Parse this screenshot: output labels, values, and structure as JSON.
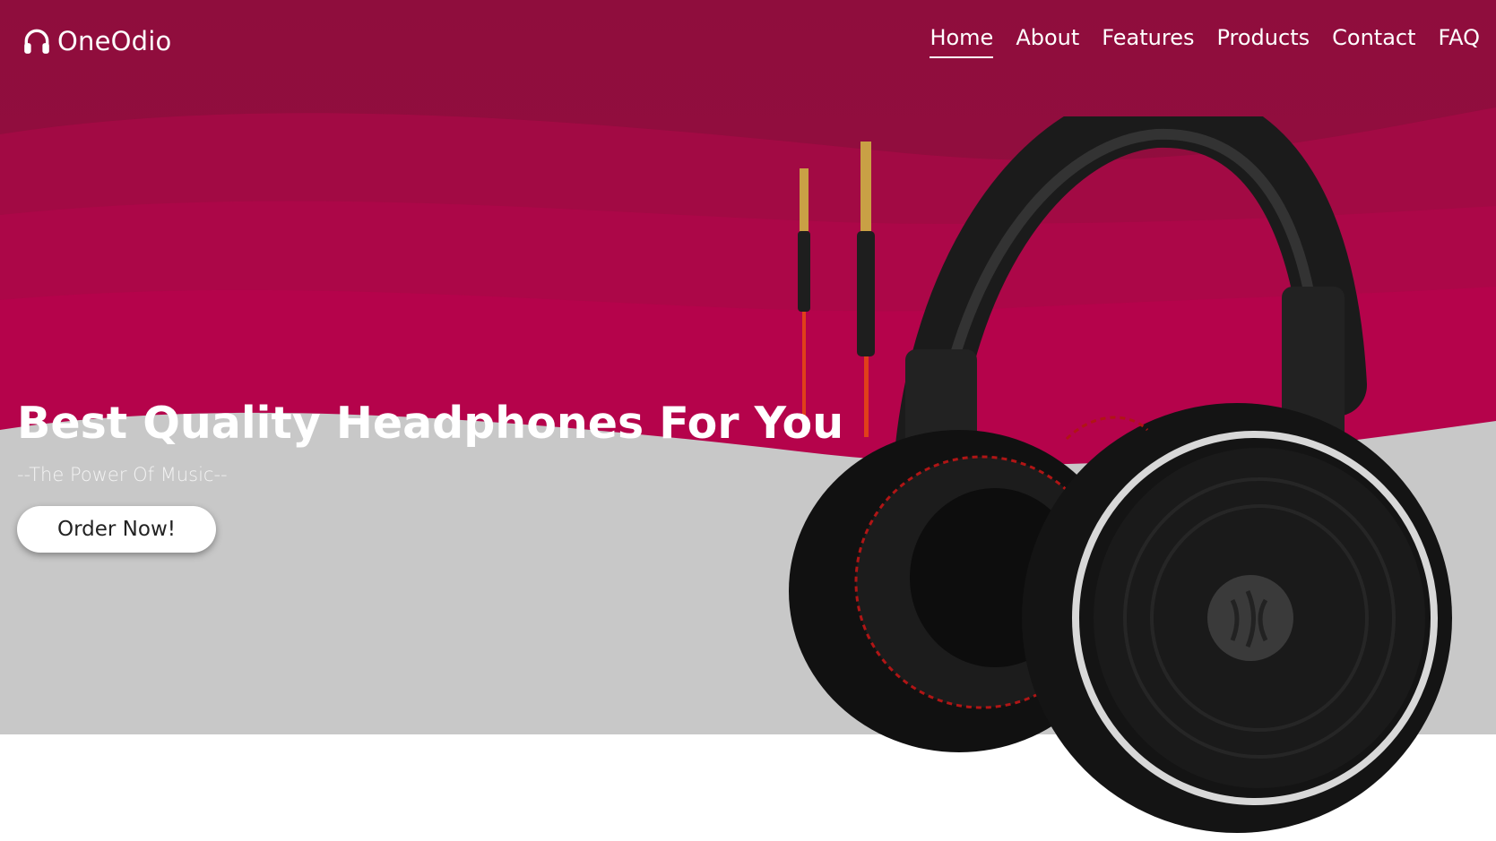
{
  "brand": {
    "name": "OneOdio",
    "icon": "headphones-icon"
  },
  "nav": {
    "items": [
      {
        "label": "Home",
        "active": true
      },
      {
        "label": "About",
        "active": false
      },
      {
        "label": "Features",
        "active": false
      },
      {
        "label": "Products",
        "active": false
      },
      {
        "label": "Contact",
        "active": false
      },
      {
        "label": "FAQ",
        "active": false
      }
    ]
  },
  "hero": {
    "headline": "Best Quality Headphones For You",
    "tagline": "--The Power Of Music--",
    "cta_label": "Order Now!"
  },
  "colors": {
    "primary": "#9a0c3f",
    "primary_light": "#b8004b",
    "band_grey": "#c8c8c8",
    "text_light": "#ffffff"
  }
}
